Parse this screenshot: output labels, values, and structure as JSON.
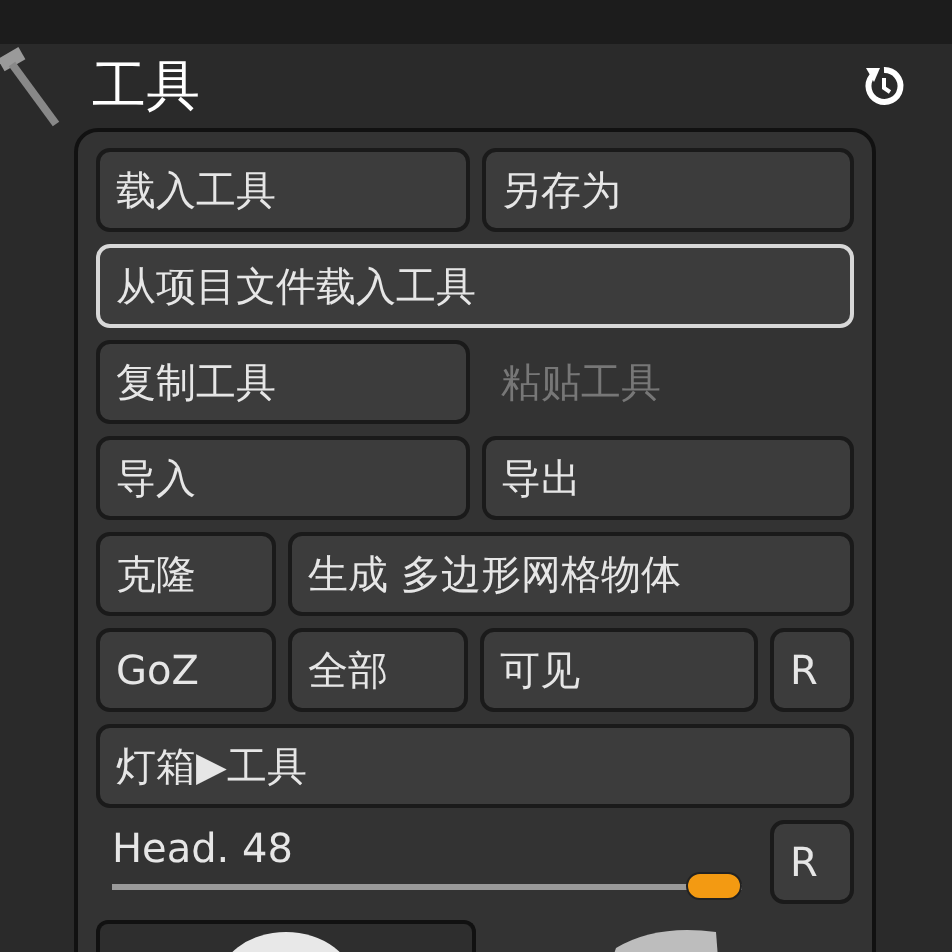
{
  "header": {
    "title": "工具"
  },
  "rows": [
    [
      {
        "label": "载入工具",
        "kind": "flex",
        "disabled": false,
        "highlighted": false
      },
      {
        "label": "另存为",
        "kind": "flex",
        "disabled": false,
        "highlighted": false
      }
    ],
    [
      {
        "label": "从项目文件载入工具",
        "kind": "flex",
        "disabled": false,
        "highlighted": true
      }
    ],
    [
      {
        "label": "复制工具",
        "kind": "flex",
        "disabled": false,
        "highlighted": false
      },
      {
        "label": "粘贴工具",
        "kind": "flex",
        "disabled": true,
        "highlighted": false
      }
    ],
    [
      {
        "label": "导入",
        "kind": "flex",
        "disabled": false,
        "highlighted": false
      },
      {
        "label": "导出",
        "kind": "flex",
        "disabled": false,
        "highlighted": false
      }
    ],
    [
      {
        "label": "克隆",
        "kind": "short",
        "disabled": false,
        "highlighted": false
      },
      {
        "label": "生成 多边形网格物体",
        "kind": "flex",
        "disabled": false,
        "highlighted": false
      }
    ],
    [
      {
        "label": "GoZ",
        "kind": "short",
        "disabled": false,
        "highlighted": false
      },
      {
        "label": "全部",
        "kind": "short",
        "disabled": false,
        "highlighted": false
      },
      {
        "label": "可见",
        "kind": "flex",
        "disabled": false,
        "highlighted": false
      },
      {
        "label": "R",
        "kind": "key",
        "disabled": false,
        "highlighted": false
      }
    ],
    [
      {
        "label": "灯箱▶工具",
        "kind": "flex",
        "disabled": false,
        "highlighted": false
      }
    ]
  ],
  "slider": {
    "label": "Head. 48",
    "level": 1.0,
    "reset": "R"
  }
}
